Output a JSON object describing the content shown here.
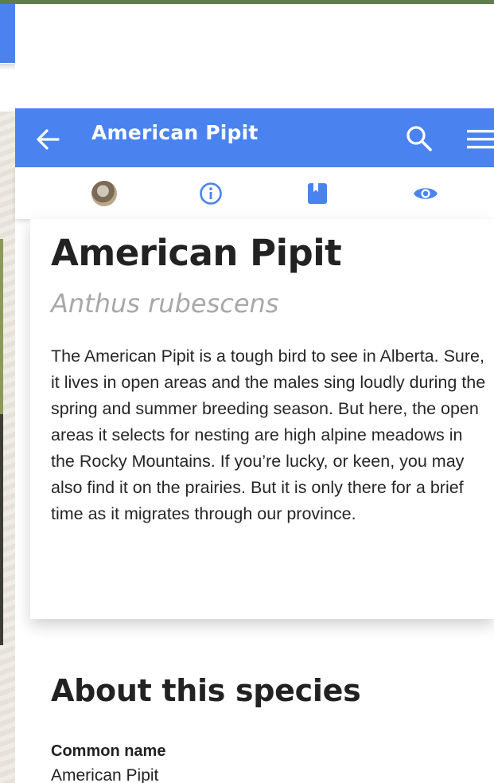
{
  "app_bar": {
    "title": "American Pipit",
    "color": "#4a83f0"
  },
  "tabs": [
    {
      "icon": "bird-photo"
    },
    {
      "icon": "info-icon"
    },
    {
      "icon": "book-icon"
    },
    {
      "icon": "eye-icon"
    }
  ],
  "species": {
    "common_name": "American Pipit",
    "latin_name": "Anthus rubescens",
    "description": "The American Pipit is a tough bird to see in Alberta. Sure, it lives in open areas and the males sing loudly during the spring and summer breeding season. But here, the open areas it selects for nesting are high alpine meadows in the Rocky Mountains. If you’re lucky, or keen, you may also find it on the prairies. But it is only there for a brief time as it migrates through our province."
  },
  "about": {
    "title": "About this species",
    "fields": [
      {
        "label": "Common name",
        "value": "American Pipit"
      }
    ]
  }
}
